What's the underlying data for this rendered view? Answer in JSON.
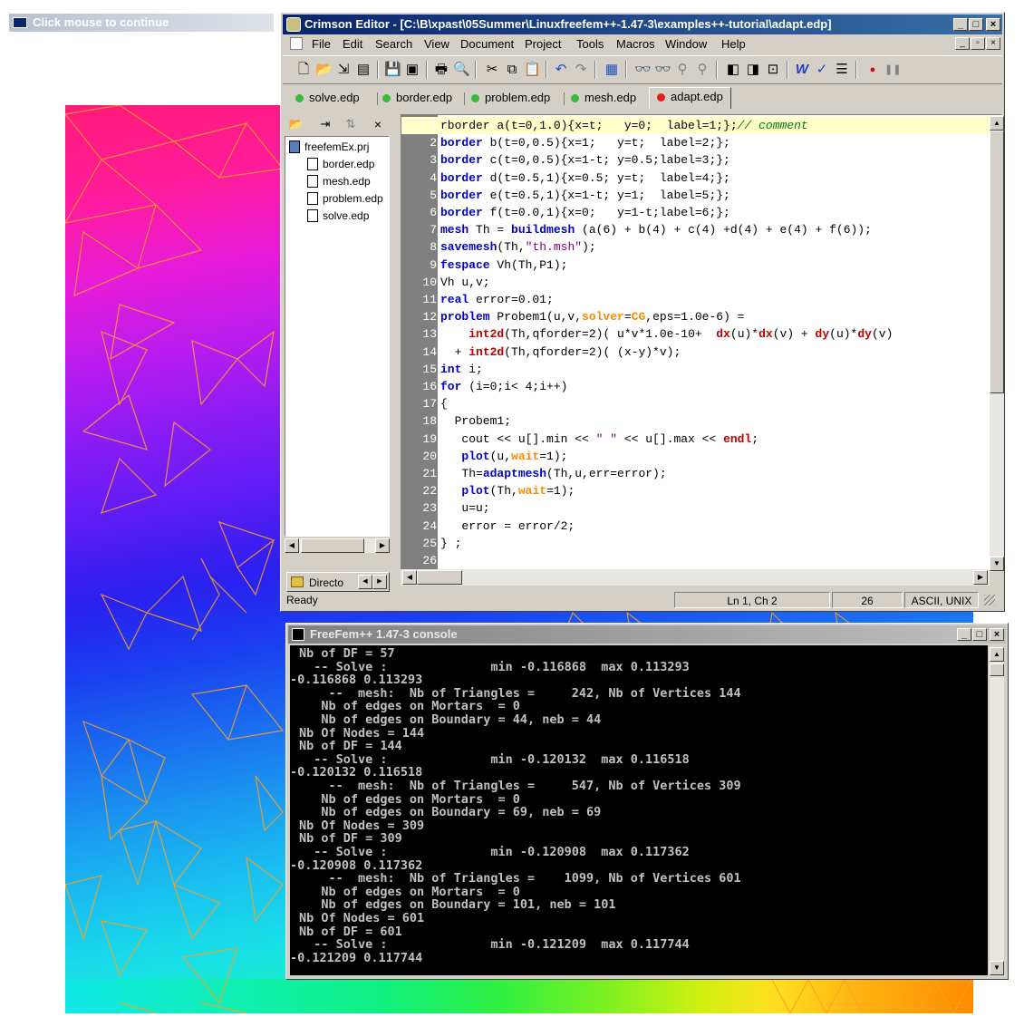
{
  "plot_window": {
    "title": "Click mouse to continue"
  },
  "editor": {
    "title": "Crimson Editor - [C:\\B\\xpast\\05Summer\\Linuxfreefem++-1.47-3\\examples++-tutorial\\adapt.edp]",
    "caption_buttons": {
      "minimize": "_",
      "maximize": "□",
      "close": "×"
    },
    "menu": [
      "File",
      "Edit",
      "Search",
      "View",
      "Document",
      "Project",
      "Tools",
      "Macros",
      "Window",
      "Help"
    ],
    "toolbar_icons": [
      "new-icon",
      "open-icon",
      "open-remote-icon",
      "save-all-icon",
      "save-icon",
      "save-as-icon",
      "print-icon",
      "print-preview-icon",
      "cut-icon",
      "copy-icon",
      "paste-icon",
      "undo-icon",
      "redo-icon",
      "column-mode-icon",
      "find-icon",
      "find-next-icon",
      "replace-icon",
      "replace-all-icon",
      "toggle-panel-icon",
      "output-window-icon",
      "fullscreen-icon",
      "word-wrap-icon",
      "spell-check-icon",
      "line-numbers-icon",
      "record-macro-icon",
      "pause-macro-icon"
    ],
    "tabs": [
      {
        "label": "solve.edp",
        "active": false
      },
      {
        "label": "border.edp",
        "active": false
      },
      {
        "label": "problem.edp",
        "active": false
      },
      {
        "label": "mesh.edp",
        "active": false
      },
      {
        "label": "adapt.edp",
        "active": true
      }
    ],
    "project": {
      "name": "freefemEx.prj",
      "files": [
        "border.edp",
        "mesh.edp",
        "problem.edp",
        "solve.edp"
      ],
      "directory_tab": "Directo"
    },
    "code_lines": [
      {
        "n": "1",
        "html": "rborder a(t=0,1.0){x=t;   y=0;  label=1;};<span class=\"cmt\">// comment</span>",
        "current": true
      },
      {
        "n": "2",
        "html": "<span class=\"kw\">border</span> b(t=0,0.5){x=1;   y=t;  label=2;};"
      },
      {
        "n": "3",
        "html": "<span class=\"kw\">border</span> c(t=0,0.5){x=1-t; y=0.5;label=3;};"
      },
      {
        "n": "4",
        "html": "<span class=\"kw\">border</span> d(t=0.5,1){x=0.5; y=t;  label=4;};"
      },
      {
        "n": "5",
        "html": "<span class=\"kw\">border</span> e(t=0.5,1){x=1-t; y=1;  label=5;};"
      },
      {
        "n": "6",
        "html": "<span class=\"kw\">border</span> f(t=0.0,1){x=0;   y=1-t;label=6;};"
      },
      {
        "n": "7",
        "html": "<span class=\"kw\">mesh</span> Th = <span class=\"kw\">buildmesh</span> (a(6) + b(4) + c(4) +d(4) + e(4) + f(6));"
      },
      {
        "n": "8",
        "html": "<span class=\"kw\">savemesh</span>(Th,<span class=\"str\">\"th.msh\"</span>);"
      },
      {
        "n": "9",
        "html": "<span class=\"kw\">fespace</span> Vh(Th,P1);"
      },
      {
        "n": "10",
        "html": "Vh u,v;"
      },
      {
        "n": "11",
        "html": "<span class=\"kw\">real</span> error=0.01;"
      },
      {
        "n": "12",
        "html": "<span class=\"kw\">problem</span> Probem1(u,v,<span class=\"param\">solver</span>=<span class=\"param\">CG</span>,eps=1.0e-6) ="
      },
      {
        "n": "13",
        "html": "    <span class=\"fn\">int2d</span>(Th,qforder=2)( u*v*1.0e-10+  <span class=\"fn\">dx</span>(u)*<span class=\"fn\">dx</span>(v) + <span class=\"fn\">dy</span>(u)*<span class=\"fn\">dy</span>(v)"
      },
      {
        "n": "14",
        "html": "  + <span class=\"fn\">int2d</span>(Th,qforder=2)( (x-y)*v);"
      },
      {
        "n": "15",
        "html": "<span class=\"kw\">int</span> i;"
      },
      {
        "n": "16",
        "html": "<span class=\"kw\">for</span> (i=0;i< 4;i++)"
      },
      {
        "n": "17",
        "html": "{"
      },
      {
        "n": "18",
        "html": "  Probem1;"
      },
      {
        "n": "19",
        "html": "   cout << u[].min << <span class=\"str\">\" \"</span> << u[].max << <span class=\"fn\">endl</span>;"
      },
      {
        "n": "20",
        "html": "   <span class=\"kw\">plot</span>(u,<span class=\"param\">wait</span>=1);"
      },
      {
        "n": "21",
        "html": "   Th=<span class=\"kw\">adaptmesh</span>(Th,u,err=error);"
      },
      {
        "n": "22",
        "html": "   <span class=\"kw\">plot</span>(Th,<span class=\"param\">wait</span>=1);"
      },
      {
        "n": "23",
        "html": "   u=u;"
      },
      {
        "n": "24",
        "html": "   error = error/2;"
      },
      {
        "n": "25",
        "html": "} ;"
      },
      {
        "n": "26",
        "html": ""
      }
    ],
    "status": {
      "text": "Ready",
      "position": "Ln 1, Ch 2",
      "count": "26",
      "encoding": "ASCII, UNIX"
    }
  },
  "console": {
    "title": "FreeFem++ 1.47-3 console",
    "lines": [
      "Nb of DF = 57",
      "  -- Solve :              min -0.116868  max 0.113293",
      "-0.116868 0.113293",
      "    --  mesh:  Nb of Triangles =     242, Nb of Vertices 144",
      "   Nb of edges on Mortars  = 0",
      "   Nb of edges on Boundary = 44, neb = 44",
      "Nb Of Nodes = 144",
      "Nb of DF = 144",
      "  -- Solve :              min -0.120132  max 0.116518",
      "-0.120132 0.116518",
      "    --  mesh:  Nb of Triangles =     547, Nb of Vertices 309",
      "   Nb of edges on Mortars  = 0",
      "   Nb of edges on Boundary = 69, neb = 69",
      "Nb Of Nodes = 309",
      "Nb of DF = 309",
      "  -- Solve :              min -0.120908  max 0.117362",
      "-0.120908 0.117362",
      "    --  mesh:  Nb of Triangles =    1099, Nb of Vertices 601",
      "   Nb of edges on Mortars  = 0",
      "   Nb of edges on Boundary = 101, neb = 101",
      "Nb Of Nodes = 601",
      "Nb of DF = 601",
      "  -- Solve :              min -0.121209  max 0.117744",
      "-0.121209 0.117744"
    ]
  }
}
